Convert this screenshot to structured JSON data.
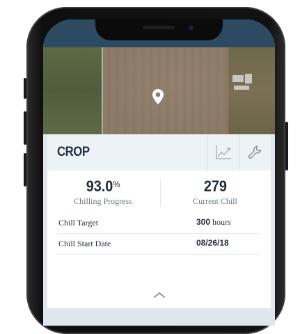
{
  "card": {
    "title": "CROP",
    "chart_icon": "line-chart-icon",
    "settings_icon": "wrench-icon"
  },
  "stats": {
    "progress_value": "93.0",
    "progress_unit": "%",
    "progress_label": "Chilling Progress",
    "chill_value": "279",
    "chill_label": "Current Chill"
  },
  "rows": [
    {
      "label": "Chill Target",
      "value": "300",
      "unit": "hours"
    },
    {
      "label": "Chill Start Date",
      "value": "08/26/18",
      "unit": ""
    }
  ],
  "map": {
    "pin_icon": "location-pin-icon"
  },
  "expand_icon": "chevron-up-icon",
  "colors": {
    "header_bar": "#2d4a63",
    "card_header_bg": "#edf2f6",
    "screen_bg": "#dfe7ee",
    "text_dark": "#22313f"
  }
}
